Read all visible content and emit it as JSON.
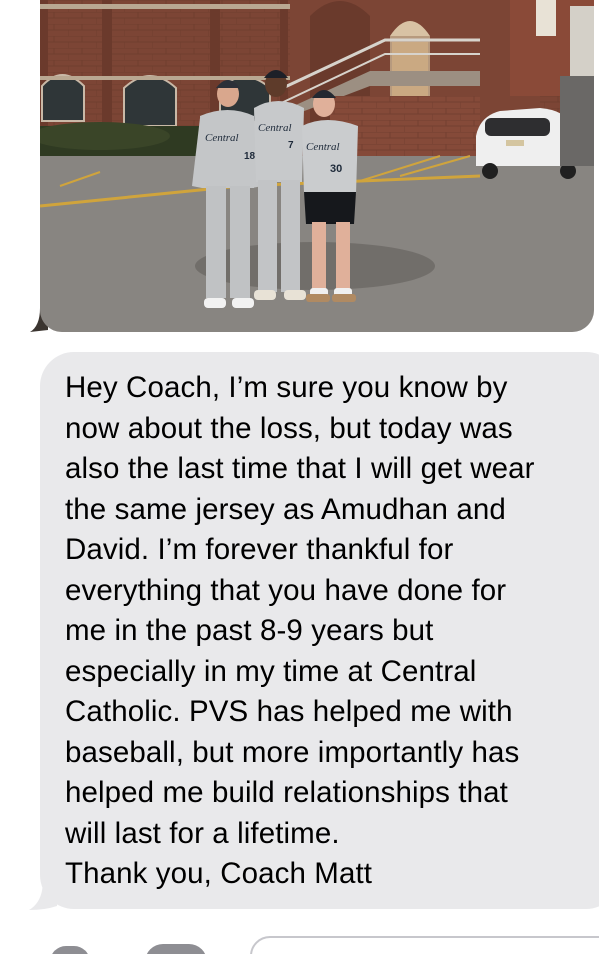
{
  "conversation": {
    "photo_message": {
      "image_name": "team-photo",
      "jersey_text": [
        "Central",
        "Central",
        "Central"
      ],
      "jersey_numbers": [
        "18",
        "7",
        "30"
      ]
    },
    "text_message": {
      "body": "Hey Coach, I’m sure you know by\nnow about the loss, but today was\nalso the last time that I will get wear\nthe same jersey as Amudhan and\nDavid. I’m forever thankful for\neverything that you have done for\nme in the past 8-9 years but\nespecially in my time at Central\nCatholic. PVS has helped me with\nbaseball, but more importantly has\nhelped me build relationships that\nwill last for a lifetime.\nThank you, Coach Matt"
    }
  },
  "colors": {
    "incoming_bubble": "#e9e9eb",
    "text": "#000000",
    "background": "#ffffff",
    "icon_gray": "#8e8e93"
  },
  "bottom_bar": {
    "icons": [
      "camera-icon",
      "app-store-icon"
    ],
    "input_placeholder": ""
  }
}
